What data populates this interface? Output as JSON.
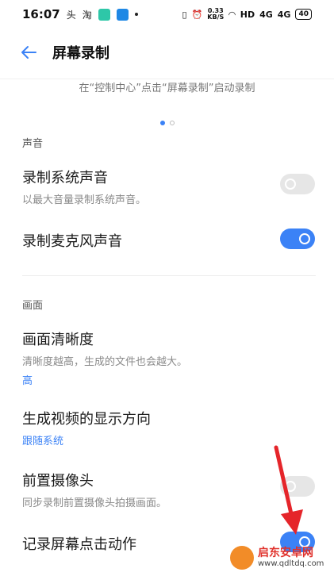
{
  "status_bar": {
    "time": "16:07",
    "left_icons": [
      "头",
      "淘"
    ],
    "speed_top": "0.33",
    "speed_bottom": "KB/S",
    "network": "HD",
    "signal1": "4G",
    "signal2": "4G",
    "battery": "40"
  },
  "header": {
    "back_icon": "arrow-left-icon",
    "title": "屏幕录制"
  },
  "hint": "在“控制中心”点击“屏幕录制”启动录制",
  "pager": {
    "active_index": 0,
    "count": 2
  },
  "sections": {
    "sound": "声音",
    "picture": "画面"
  },
  "rows": {
    "system_sound": {
      "title": "录制系统声音",
      "subtitle": "以最大音量录制系统声音。",
      "enabled": false
    },
    "mic_sound": {
      "title": "录制麦克风声音",
      "enabled": true
    },
    "resolution": {
      "title": "画面清晰度",
      "subtitle": "清晰度越高，生成的文件也会越大。",
      "value": "高"
    },
    "orientation": {
      "title": "生成视频的显示方向",
      "value": "跟随系统"
    },
    "front_camera": {
      "title": "前置摄像头",
      "subtitle": "同步录制前置摄像头拍摄画面。",
      "enabled": false
    },
    "record_touches": {
      "title": "记录屏幕点击动作",
      "enabled": true
    }
  },
  "colors": {
    "accent": "#3b82f6",
    "arrow": "#e5252a"
  },
  "watermark": {
    "name": "启东安卓网",
    "url": "www.qdltdq.com"
  }
}
